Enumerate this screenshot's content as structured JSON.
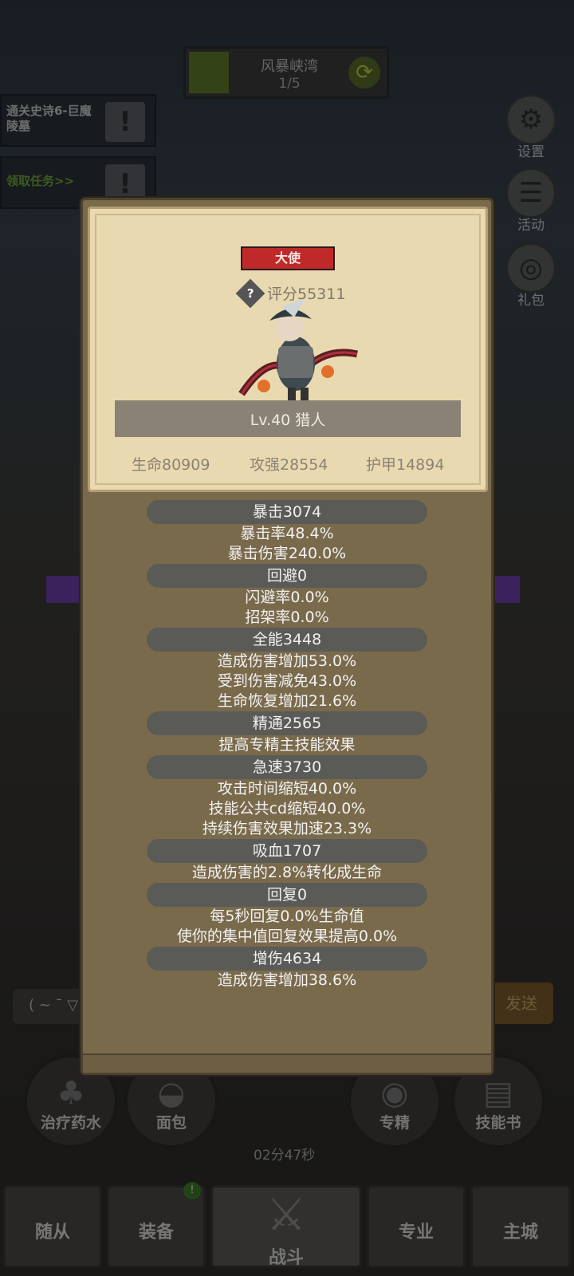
{
  "stage": {
    "name": "风暴峡湾",
    "progress": "1/5"
  },
  "quests": [
    {
      "text": "通关史诗6-巨魔陵墓"
    },
    {
      "text": "领取任务>>"
    }
  ],
  "side_menu": {
    "settings": "设置",
    "activity": "活动",
    "gift": "礼包"
  },
  "modal": {
    "rank": "大使",
    "score": "评分55311",
    "name": "Lv.40 猎人",
    "basic": {
      "hp": "生命80909",
      "atk": "攻强28554",
      "armor": "护甲14894"
    },
    "groups": [
      {
        "head": "暴击3074",
        "lines": [
          "暴击率48.4%",
          "暴击伤害240.0%"
        ]
      },
      {
        "head": "回避0",
        "lines": [
          "闪避率0.0%",
          "招架率0.0%"
        ]
      },
      {
        "head": "全能3448",
        "lines": [
          "造成伤害增加53.0%",
          "受到伤害减免43.0%",
          "生命恢复增加21.6%"
        ]
      },
      {
        "head": "精通2565",
        "lines": [
          "提高专精主技能效果"
        ]
      },
      {
        "head": "急速3730",
        "lines": [
          "攻击时间缩短40.0%",
          "技能公共cd缩短40.0%",
          "持续伤害效果加速23.3%"
        ]
      },
      {
        "head": "吸血1707",
        "lines": [
          "造成伤害的2.8%转化成生命"
        ]
      },
      {
        "head": "回复0",
        "lines": [
          "每5秒回复0.0%生命值",
          "使你的集中值回复效果提高0.0%"
        ]
      },
      {
        "head": "增伤4634",
        "lines": [
          "造成伤害增加38.6%"
        ]
      }
    ]
  },
  "chat": {
    "hint": "( ~ ¯ ▽",
    "send": "发送"
  },
  "actions": {
    "potion": "治疗药水",
    "bread": "面包",
    "spec": "专精",
    "skillbook": "技能书",
    "timer": "02分47秒"
  },
  "nav": {
    "follower": "随从",
    "equipment": "装备",
    "battle": "战斗",
    "profession": "专业",
    "city": "主城",
    "badge": "!"
  },
  "colors": {
    "rank_badge": "#c0292a",
    "card_bg": "#e9d9b1",
    "modal_bg": "#7a6a4c"
  }
}
